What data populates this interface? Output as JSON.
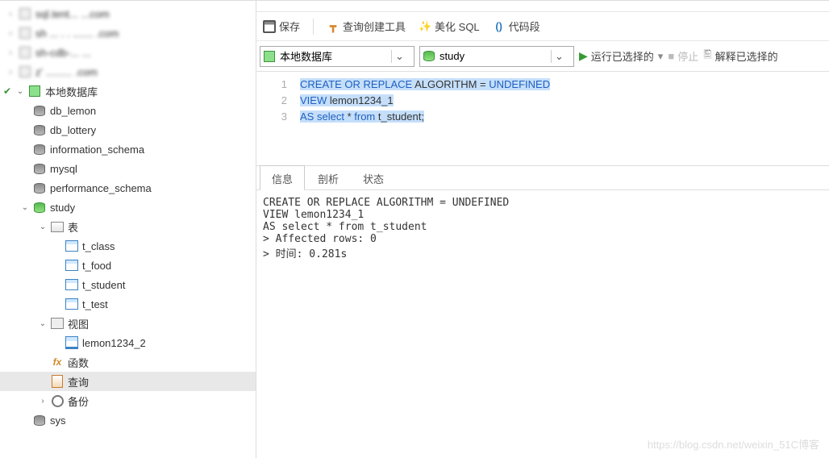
{
  "sidebar": {
    "conns": [
      {
        "label": "sql.tent... ...com",
        "icon": "conn"
      },
      {
        "label": "sh ... . . ....... .com",
        "icon": "conn"
      },
      {
        "label": "sh-cdb-... ...",
        "icon": "conn"
      },
      {
        "label": "z' ......... .com",
        "icon": "conn"
      }
    ],
    "localdb": {
      "label": "本地数据库"
    },
    "databases": [
      {
        "label": "db_lemon"
      },
      {
        "label": "db_lottery"
      },
      {
        "label": "information_schema"
      },
      {
        "label": "mysql"
      },
      {
        "label": "performance_schema"
      }
    ],
    "study": {
      "label": "study"
    },
    "tables_label": "表",
    "tables": [
      {
        "label": "t_class"
      },
      {
        "label": "t_food"
      },
      {
        "label": "t_student"
      },
      {
        "label": "t_test"
      }
    ],
    "views_label": "视图",
    "views": [
      {
        "label": "lemon1234_2"
      }
    ],
    "functions": "函数",
    "queries": "查询",
    "backup": "备份",
    "sys": "sys"
  },
  "toolbar1": {
    "save": "保存",
    "plan": "查询创建工具",
    "beautify": "美化 SQL",
    "snippet": "代码段"
  },
  "toolbar2": {
    "conn": "本地数据库",
    "db": "study",
    "run": "运行已选择的",
    "stop": "停止",
    "explain": "解释已选择的"
  },
  "editor": {
    "lines": [
      "1",
      "2",
      "3"
    ],
    "l1": {
      "a": "CREATE",
      "b": "OR",
      "c": "REPLACE",
      "d": "ALGORITHM",
      "e": "=",
      "f": "UNDEFINED"
    },
    "l2": {
      "a": "VIEW",
      "b": "lemon1234_1"
    },
    "l3": {
      "a": "AS",
      "b": "select",
      "c": "*",
      "d": "from",
      "e": "t_student;"
    }
  },
  "result": {
    "tabs": [
      "信息",
      "剖析",
      "状态"
    ],
    "out": "CREATE OR REPLACE ALGORITHM = UNDEFINED\nVIEW lemon1234_1\nAS select * from t_student\n> Affected rows: 0\n> 时间: 0.281s"
  },
  "watermark": "https://blog.csdn.net/weixin_51C博客"
}
